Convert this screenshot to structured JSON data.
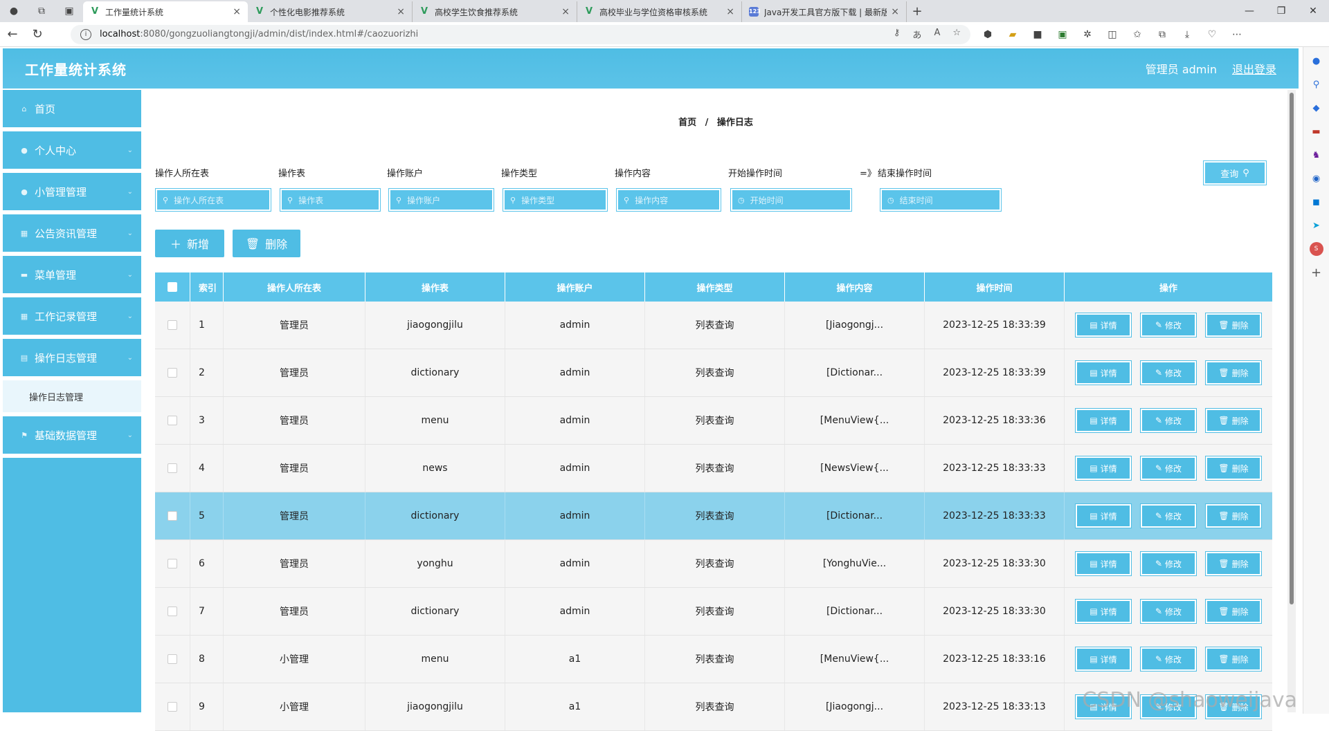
{
  "browser": {
    "tabs": [
      {
        "title": "工作量统计系统",
        "active": true,
        "icon": "vue-icon"
      },
      {
        "title": "个性化电影推荐系统",
        "active": false,
        "icon": "vue-icon"
      },
      {
        "title": "高校学生饮食推荐系统",
        "active": false,
        "icon": "vue-icon"
      },
      {
        "title": "高校毕业与学位资格审核系统",
        "active": false,
        "icon": "vue-icon"
      },
      {
        "title": "Java开发工具官方版下载 | 最新版",
        "active": false,
        "icon": "site-icon"
      }
    ],
    "url_host": "localhost",
    "url_path": ":8080/gongzuoliangtongji/admin/dist/index.html#/caozuorizhi"
  },
  "header": {
    "title": "工作量统计系统",
    "user": "管理员 admin",
    "logout": "退出登录"
  },
  "sidebar": {
    "items": [
      {
        "label": "首页",
        "icon": "home-icon"
      },
      {
        "label": "个人中心",
        "icon": "user-icon"
      },
      {
        "label": "小管理管理",
        "icon": "user-icon"
      },
      {
        "label": "公告资讯管理",
        "icon": "grid-icon"
      },
      {
        "label": "菜单管理",
        "icon": "monitor-icon"
      },
      {
        "label": "工作记录管理",
        "icon": "grid-icon"
      },
      {
        "label": "操作日志管理",
        "icon": "doc-icon"
      },
      {
        "label": "基础数据管理",
        "icon": "flag-icon"
      }
    ],
    "submenu": "操作日志管理"
  },
  "breadcrumb": {
    "home": "首页",
    "sep": "/",
    "current": "操作日志"
  },
  "filters": {
    "labels": [
      "操作人所在表",
      "操作表",
      "操作账户",
      "操作类型",
      "操作内容",
      "开始操作时间",
      "结束操作时间"
    ],
    "placeholders": [
      "操作人所在表",
      "操作表",
      "操作账户",
      "操作类型",
      "操作内容",
      "开始时间",
      "结束时间"
    ],
    "range_sep": "=》",
    "query": "查询"
  },
  "actions": {
    "add": "新增",
    "delete": "删除"
  },
  "table": {
    "headers": [
      "索引",
      "操作人所在表",
      "操作表",
      "操作账户",
      "操作类型",
      "操作内容",
      "操作时间",
      "操作"
    ],
    "row_actions": {
      "detail": "详情",
      "edit": "修改",
      "delete": "删除"
    },
    "rows": [
      {
        "idx": "1",
        "opt": "管理员",
        "tbl": "jiaogongjilu",
        "acc": "admin",
        "typ": "列表查询",
        "con": "[Jiaogongj...",
        "time": "2023-12-25 18:33:39"
      },
      {
        "idx": "2",
        "opt": "管理员",
        "tbl": "dictionary",
        "acc": "admin",
        "typ": "列表查询",
        "con": "[Dictionar...",
        "time": "2023-12-25 18:33:39"
      },
      {
        "idx": "3",
        "opt": "管理员",
        "tbl": "menu",
        "acc": "admin",
        "typ": "列表查询",
        "con": "[MenuView{...",
        "time": "2023-12-25 18:33:36"
      },
      {
        "idx": "4",
        "opt": "管理员",
        "tbl": "news",
        "acc": "admin",
        "typ": "列表查询",
        "con": "[NewsView{...",
        "time": "2023-12-25 18:33:33"
      },
      {
        "idx": "5",
        "opt": "管理员",
        "tbl": "dictionary",
        "acc": "admin",
        "typ": "列表查询",
        "con": "[Dictionar...",
        "time": "2023-12-25 18:33:33"
      },
      {
        "idx": "6",
        "opt": "管理员",
        "tbl": "yonghu",
        "acc": "admin",
        "typ": "列表查询",
        "con": "[YonghuVie...",
        "time": "2023-12-25 18:33:30"
      },
      {
        "idx": "7",
        "opt": "管理员",
        "tbl": "dictionary",
        "acc": "admin",
        "typ": "列表查询",
        "con": "[Dictionar...",
        "time": "2023-12-25 18:33:30"
      },
      {
        "idx": "8",
        "opt": "小管理",
        "tbl": "menu",
        "acc": "a1",
        "typ": "列表查询",
        "con": "[MenuView{...",
        "time": "2023-12-25 18:33:16"
      },
      {
        "idx": "9",
        "opt": "小管理",
        "tbl": "jiaogongjilu",
        "acc": "a1",
        "typ": "列表查询",
        "con": "[Jiaogongj...",
        "time": "2023-12-25 18:33:13"
      }
    ]
  },
  "watermark": "CSDN @shaoweijava",
  "colors": {
    "primary": "#4fbde4",
    "highlight_row": "#8bd2ec"
  }
}
